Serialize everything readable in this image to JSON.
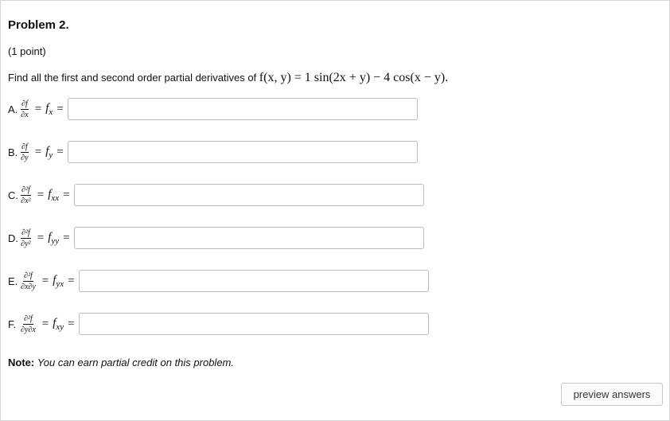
{
  "problem": {
    "title": "Problem 2.",
    "points": "(1 point)",
    "question_text": "Find all the first and second order partial derivatives of",
    "function": "f(x, y) = 1 sin(2x + y) − 4 cos(x − y)."
  },
  "parts": [
    {
      "letter": "A.",
      "num": "∂f",
      "den": "∂x",
      "fname": "f",
      "sub": "x",
      "value": ""
    },
    {
      "letter": "B.",
      "num": "∂f",
      "den": "∂y",
      "fname": "f",
      "sub": "y",
      "value": ""
    },
    {
      "letter": "C.",
      "num": "∂²f",
      "den": "∂x²",
      "fname": "f",
      "sub": "xx",
      "value": ""
    },
    {
      "letter": "D.",
      "num": "∂²f",
      "den": "∂y²",
      "fname": "f",
      "sub": "yy",
      "value": ""
    },
    {
      "letter": "E.",
      "num": "∂²f",
      "den": "∂x∂y",
      "fname": "f",
      "sub": "yx",
      "value": ""
    },
    {
      "letter": "F.",
      "num": "∂²f",
      "den": "∂y∂x",
      "fname": "f",
      "sub": "xy",
      "value": ""
    }
  ],
  "note": {
    "label": "Note:",
    "text": "You can earn partial credit on this problem."
  },
  "buttons": {
    "preview": "preview answers"
  }
}
